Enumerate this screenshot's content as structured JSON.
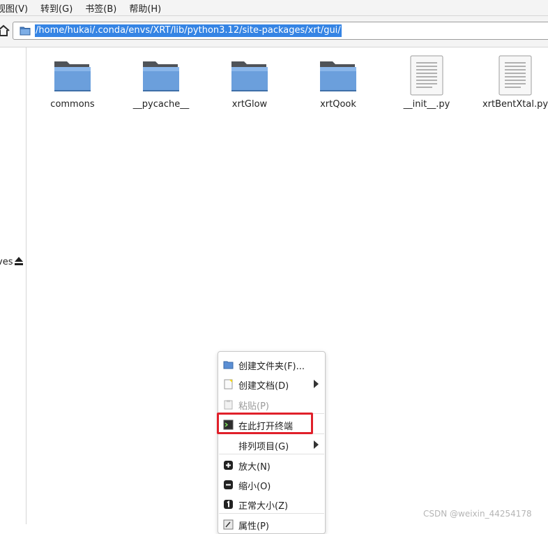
{
  "menubar": {
    "items": [
      "视图(V)",
      "转到(G)",
      "书签(B)",
      "帮助(H)"
    ]
  },
  "location": {
    "path": "/home/hukai/.conda/envs/XRT/lib/python3.12/site-packages/xrt/gui/"
  },
  "sidepane": {
    "label": "ves"
  },
  "files": [
    {
      "name": "commons",
      "type": "folder"
    },
    {
      "name": "__pycache__",
      "type": "folder"
    },
    {
      "name": "xrtGlow",
      "type": "folder"
    },
    {
      "name": "xrtQook",
      "type": "folder"
    },
    {
      "name": "__init__.py",
      "type": "text-file"
    },
    {
      "name": "xrtBentXtal.py",
      "type": "text-file"
    }
  ],
  "context_menu": {
    "items": [
      {
        "label": "创建文件夹(F)...",
        "icon": "new-folder-icon",
        "enabled": true
      },
      {
        "label": "创建文档(D)",
        "icon": "new-document-icon",
        "enabled": true,
        "submenu": true
      },
      {
        "label": "粘贴(P)",
        "icon": "paste-icon",
        "enabled": false
      },
      {
        "label": "在此打开终端",
        "icon": "terminal-icon",
        "enabled": true
      },
      {
        "label": "排列项目(G)",
        "icon": "",
        "enabled": true,
        "submenu": true
      },
      {
        "label": "放大(N)",
        "icon": "zoom-in-icon",
        "enabled": true
      },
      {
        "label": "缩小(O)",
        "icon": "zoom-out-icon",
        "enabled": true
      },
      {
        "label": "正常大小(Z)",
        "icon": "zoom-normal-icon",
        "enabled": true
      },
      {
        "label": "属性(P)",
        "icon": "properties-icon",
        "enabled": true
      }
    ]
  },
  "colors": {
    "selection": "#3584e4",
    "highlight_box": "#e0202a",
    "folder": "#5b8fd4"
  },
  "watermark": "CSDN @weixin_44254178"
}
